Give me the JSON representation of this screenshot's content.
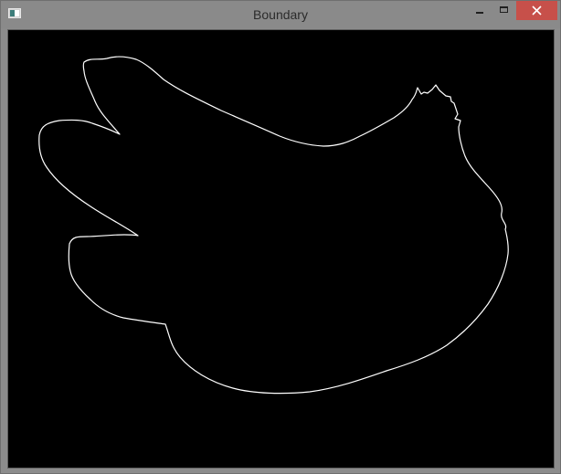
{
  "window": {
    "title": "Boundary",
    "app_icon": "opencv-window-icon",
    "controls": {
      "minimize_icon": "minimize-icon",
      "maximize_icon": "maximize-icon",
      "close_icon": "close-icon"
    },
    "colors": {
      "close_button": "#c7504a",
      "canvas_background": "#000000",
      "boundary_stroke": "#ffffff"
    }
  }
}
